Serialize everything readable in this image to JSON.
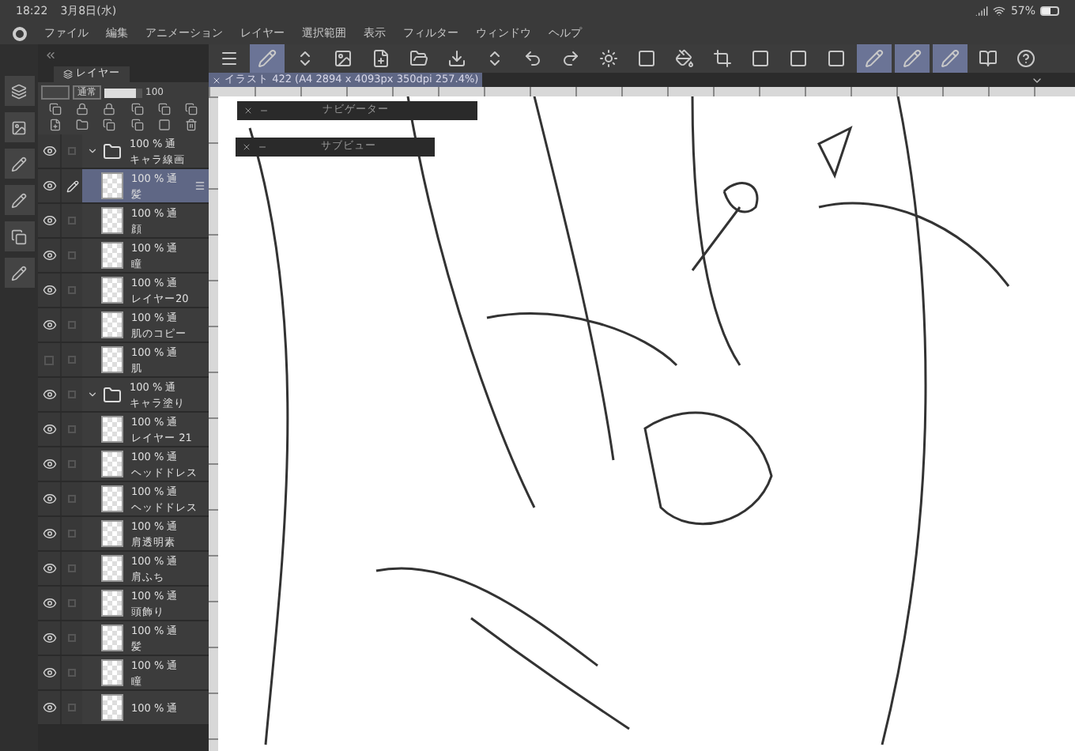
{
  "status_bar": {
    "time": "18:22",
    "date": "3月8日(水)",
    "battery": "57%"
  },
  "menu": [
    "ファイル",
    "編集",
    "アニメーション",
    "レイヤー",
    "選択範囲",
    "表示",
    "フィルター",
    "ウィンドウ",
    "ヘルプ"
  ],
  "layer_panel": {
    "title": "レイヤー",
    "blend_mode": "通常",
    "opacity": "100",
    "opacity_slider": {
      "level": 0.85
    },
    "layers": [
      {
        "kind": "folder",
        "mode": "100 % 通",
        "name": "キャラ線画",
        "visible": true,
        "selected": false,
        "editing": false,
        "indent": false
      },
      {
        "kind": "layer",
        "mode": "100 % 通",
        "name": "髪",
        "visible": true,
        "selected": true,
        "editing": true,
        "indent": true
      },
      {
        "kind": "layer",
        "mode": "100 % 通",
        "name": "顔",
        "visible": true,
        "selected": false,
        "editing": false,
        "indent": true
      },
      {
        "kind": "layer",
        "mode": "100 % 通",
        "name": "瞳",
        "visible": true,
        "selected": false,
        "editing": false,
        "indent": true
      },
      {
        "kind": "layer",
        "mode": "100 % 通",
        "name": "レイヤー20",
        "visible": true,
        "selected": false,
        "editing": false,
        "indent": true
      },
      {
        "kind": "layer",
        "mode": "100 % 通",
        "name": "肌のコピー",
        "visible": true,
        "selected": false,
        "editing": false,
        "indent": true
      },
      {
        "kind": "layer",
        "mode": "100 % 通",
        "name": "肌",
        "visible": false,
        "selected": false,
        "editing": false,
        "indent": true
      },
      {
        "kind": "folder",
        "mode": "100 % 通",
        "name": "キャラ塗り",
        "visible": true,
        "selected": false,
        "editing": false,
        "indent": false
      },
      {
        "kind": "layer",
        "mode": "100 % 通",
        "name": "レイヤー 21",
        "visible": true,
        "selected": false,
        "editing": false,
        "indent": true
      },
      {
        "kind": "layer",
        "mode": "100 % 通",
        "name": "ヘッドドレス",
        "visible": true,
        "selected": false,
        "editing": false,
        "indent": true
      },
      {
        "kind": "layer",
        "mode": "100 % 通",
        "name": "ヘッドドレス",
        "visible": true,
        "selected": false,
        "editing": false,
        "indent": true
      },
      {
        "kind": "layer",
        "mode": "100 % 通",
        "name": "肩透明素",
        "visible": true,
        "selected": false,
        "editing": false,
        "indent": true
      },
      {
        "kind": "layer",
        "mode": "100 % 通",
        "name": "肩ふち",
        "visible": true,
        "selected": false,
        "editing": false,
        "indent": true
      },
      {
        "kind": "layer",
        "mode": "100 % 通",
        "name": "頭飾り",
        "visible": true,
        "selected": false,
        "editing": false,
        "indent": true
      },
      {
        "kind": "layer",
        "mode": "100 % 通",
        "name": "髪",
        "visible": true,
        "selected": false,
        "editing": false,
        "indent": true
      },
      {
        "kind": "layer",
        "mode": "100 % 通",
        "name": "瞳",
        "visible": true,
        "selected": false,
        "editing": false,
        "indent": true
      },
      {
        "kind": "layer",
        "mode": "100 % 通",
        "visible": true,
        "selected": false,
        "editing": false,
        "indent": true
      }
    ]
  },
  "canvas_tab": {
    "title": "イラスト 422 (A4 2894 x 4093px 350dpi 257.4%)"
  },
  "floating_panels": [
    {
      "title": "ナビゲーター"
    },
    {
      "title": "サブビュー"
    }
  ]
}
